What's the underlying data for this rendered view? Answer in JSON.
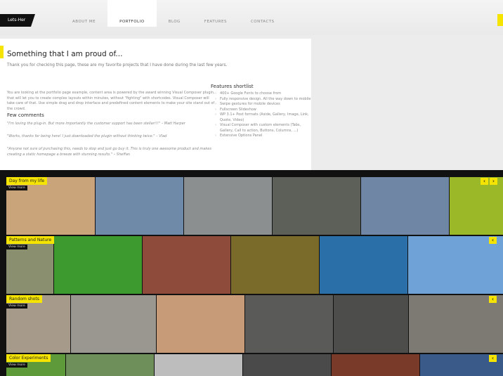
{
  "header": {
    "logo_text": "Lets-Her",
    "nav": [
      "ABOUT ME",
      "PORTFOLIO",
      "BLOG",
      "FEATURES",
      "CONTACTS"
    ],
    "active_nav_index": 1,
    "accent": "#f5e400"
  },
  "content": {
    "title": "Something that I am proud of...",
    "intro": "Thank you for checking this page, these are my favorite projects that I have done during the last few years.",
    "body": "You are looking at the portfolio page example, content area is powered by the award winning Visual Composer plugin, that will let you to create complex layouts within minutes, without \"fighting\" with shortcodes. Visual Composer will take care of that. Use simple drag and drop interface and predefined content elements to make your site stand out of the crowd.",
    "comments_title": "Few comments",
    "comments": [
      "\"I'm loving the plug-in. But more importantly the customer support has been stellar!!!\" – Matt Harper",
      "\"Works, thanks for being here! I just downloaded the plugin without thinking twice.\" – Vlad",
      "\"Anyone not sure of purchasing this, needs to stop and just go buy it. This is truly one awesome product and makes creating a static homepage a breeze with stunning results.\" – Sheffan"
    ],
    "features_title": "Features shortlist",
    "features": [
      "400+ Google Fonts to choose from",
      "Fully responsive design. All the way down to mobile",
      "Swipe gestures for mobile devices",
      "Fullscreen Slideshow",
      "WP 3.1+ Post formats (Aside, Gallery, Image, Link, Quote, Video)",
      "Visual Composer with custom elements (Tabs, Gallery, Call to action, Buttons, Columns, ...)",
      "Extensive Options Panel"
    ]
  },
  "gallery": {
    "rows": [
      {
        "label": "Day from my life",
        "sub": "View more",
        "thumbs": [
          "#c9a47a",
          "#6e8aa8",
          "#8c8f90",
          "#5d6058",
          "#6f86a5",
          "#9bb828"
        ]
      },
      {
        "label": "Patterns and Nature",
        "sub": "View more",
        "thumbs": [
          "#8a8f70",
          "#3c9a2e",
          "#8e4a3a",
          "#7a6b2a",
          "#2a6fa8",
          "#6fa3d8"
        ]
      },
      {
        "label": "Random shots",
        "sub": "View more",
        "thumbs": [
          "#a69a8a",
          "#9a9690",
          "#c79a78",
          "#5a5a58",
          "#4d4d4b",
          "#7d7a74"
        ]
      },
      {
        "label": "Color Experiments",
        "sub": "View more",
        "thumbs": [
          "#5f9a3a",
          "#6f8f5a",
          "#bdbdbd",
          "#4a4a4a",
          "#7a3a2a",
          "#3a5a8a"
        ]
      }
    ]
  }
}
